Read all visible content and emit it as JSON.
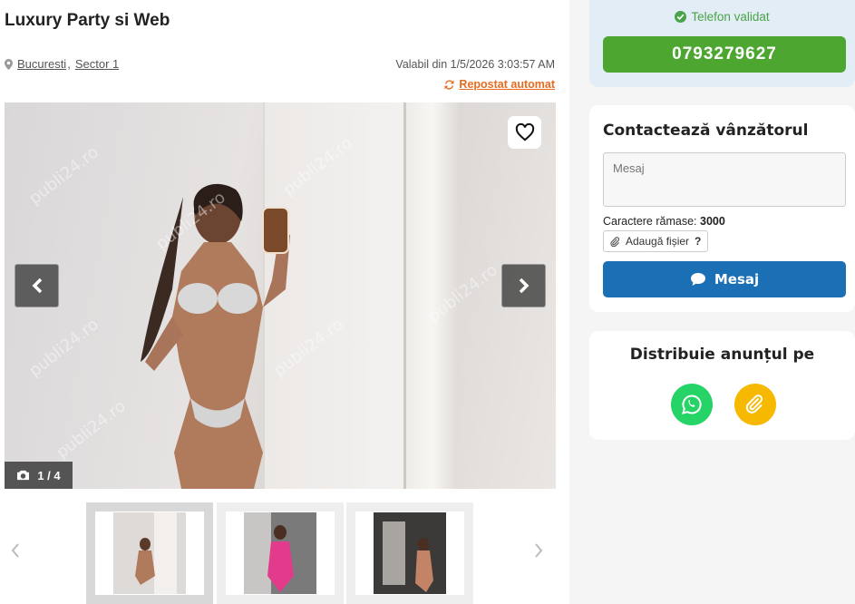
{
  "listing": {
    "title": "Luxury Party si Web",
    "city": "Bucuresti",
    "sector": "Sector 1",
    "location_separator": ",",
    "valid_from": "Valabil din 1/5/2026 3:03:57 AM",
    "repost": "Repostat automat"
  },
  "gallery": {
    "counter": "1 / 4",
    "watermark": "publi24.ro",
    "thumbnails": [
      {
        "alt": "thumbnail-1",
        "active": true
      },
      {
        "alt": "thumbnail-2",
        "active": false
      },
      {
        "alt": "thumbnail-3",
        "active": false
      }
    ]
  },
  "sidebar": {
    "phone_validated": "Telefon validat",
    "phone_number": "0793279627",
    "contact_title": "Contactează vânzătorul",
    "message_placeholder": "Mesaj",
    "chars_label": "Caractere rămase:",
    "chars_count": "3000",
    "attach_label": "Adaugă fișier",
    "attach_help": "?",
    "send_label": "Mesaj",
    "share_title": "Distribuie anunțul pe"
  },
  "colors": {
    "accent_green": "#4ca62f",
    "accent_blue": "#1a6fb5",
    "accent_orange": "#e66b1e",
    "whatsapp": "#25d366",
    "copy_link": "#f7b800"
  },
  "icons": [
    "map-pin-icon",
    "refresh-icon",
    "heart-icon",
    "chevron-left-icon",
    "chevron-right-icon",
    "camera-icon",
    "check-circle-icon",
    "paperclip-icon",
    "chat-bubble-icon",
    "whatsapp-icon",
    "link-icon"
  ]
}
